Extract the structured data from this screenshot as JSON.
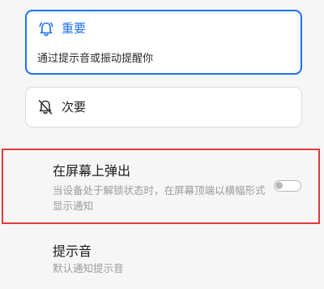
{
  "important_option": {
    "label": "重要",
    "description": "通过提示音或振动提醒你",
    "icon": "bell-ringing-icon",
    "selected": true,
    "accent_color": "#1a6ff2"
  },
  "secondary_option": {
    "label": "次要",
    "icon": "bell-off-icon",
    "selected": false
  },
  "popup_setting": {
    "title": "在屏幕上弹出",
    "description": "当设备处于解锁状态时，在屏幕顶端以横幅形式显示通知",
    "toggle_on": false,
    "highlight_color": "#e03a3e"
  },
  "sound_setting": {
    "title": "提示音",
    "value": "默认通知提示音"
  }
}
